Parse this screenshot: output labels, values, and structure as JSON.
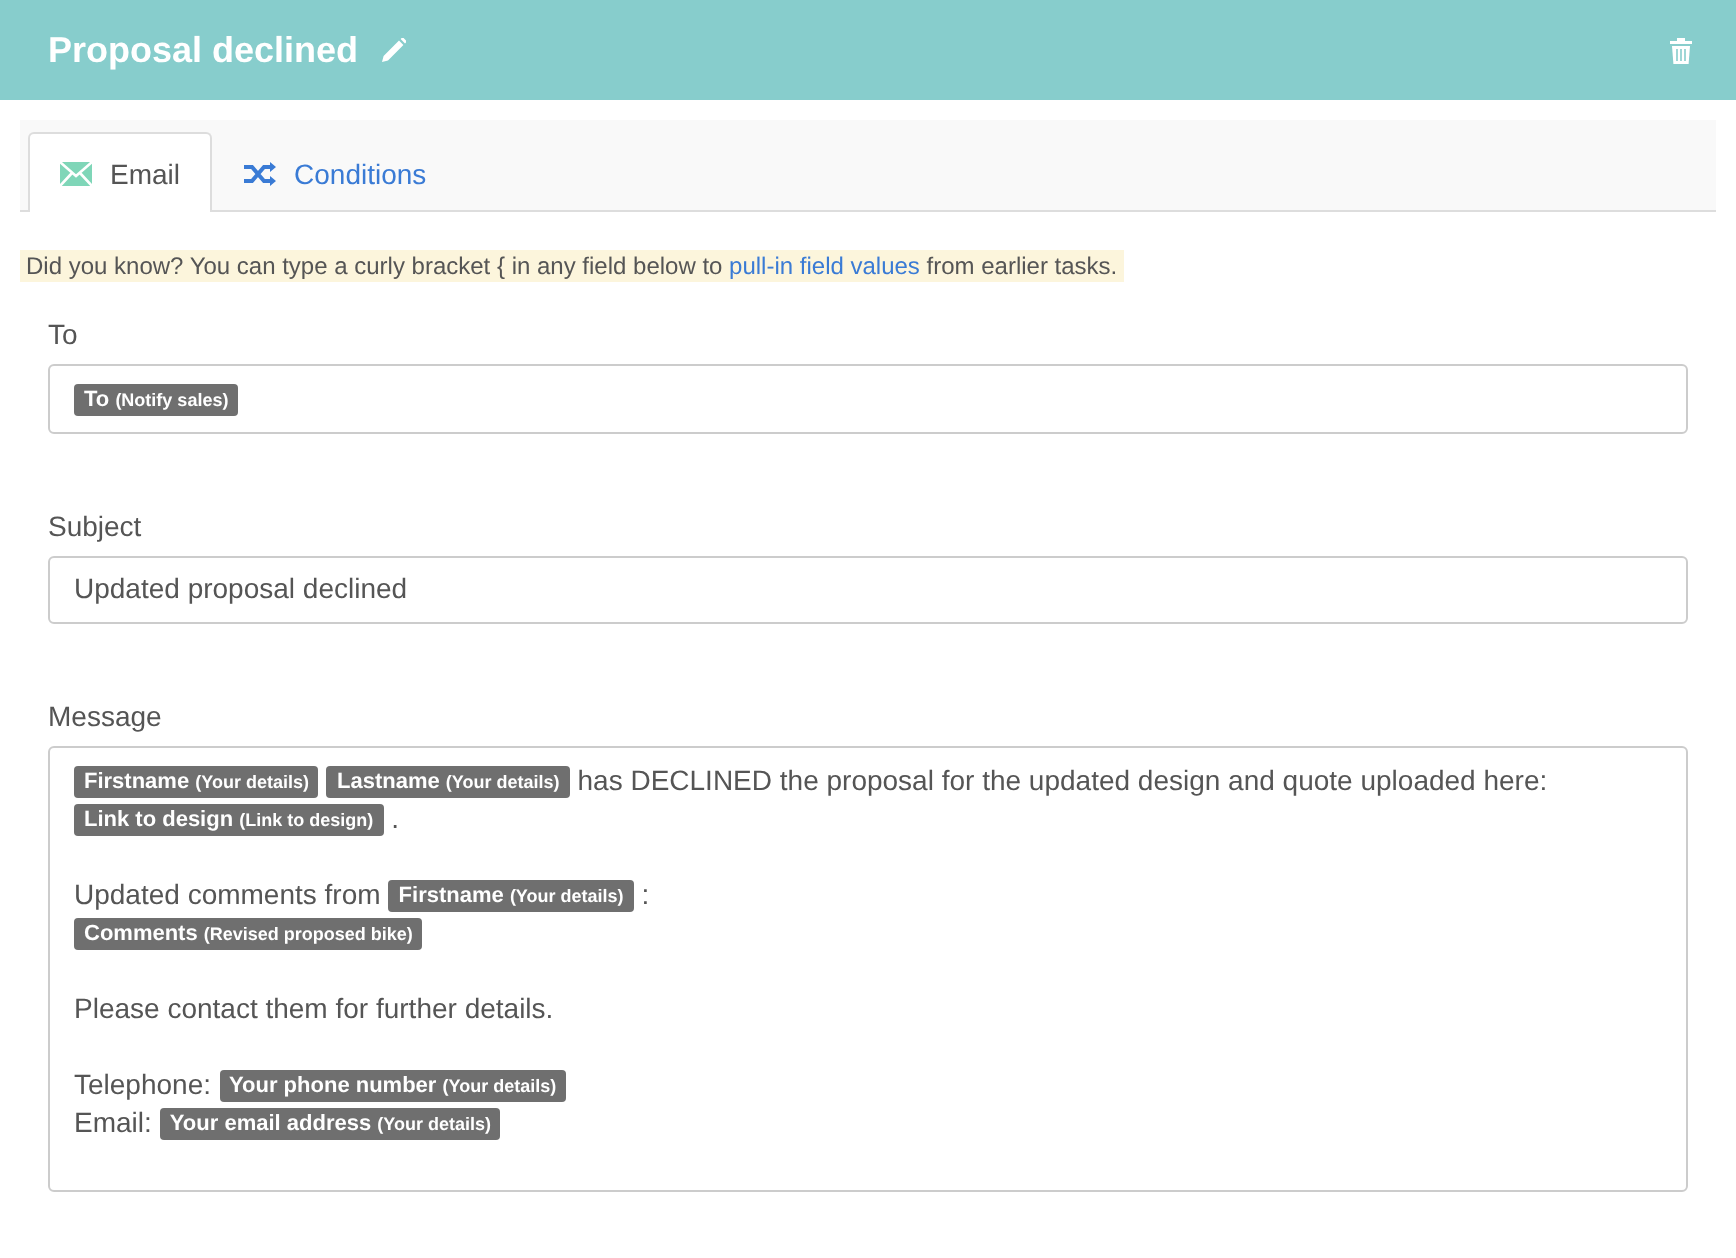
{
  "header": {
    "title": "Proposal declined"
  },
  "tabs": [
    {
      "label": "Email",
      "kind": "email",
      "selected": true
    },
    {
      "label": "Conditions",
      "kind": "conditions",
      "selected": false
    }
  ],
  "hint": {
    "before": "Did you know? You can type a curly bracket { in any field below to",
    "link": "pull-in field values",
    "after": "from earlier tasks."
  },
  "fields": [
    {
      "label": "To",
      "kind": "tags",
      "paragraphs": [
        [
          [
            {
              "kind": "tag",
              "name": "To",
              "source": "(Notify sales)"
            }
          ]
        ]
      ]
    },
    {
      "label": "Subject",
      "kind": "text",
      "value": "Updated proposal declined"
    },
    {
      "label": "Message",
      "kind": "tags",
      "paragraphs": [
        [
          [
            {
              "kind": "tag",
              "name": "Firstname",
              "source": "(Your details)"
            },
            {
              "kind": "tag",
              "name": "Lastname",
              "source": "(Your details)"
            },
            {
              "kind": "text",
              "text": "has DECLINED the proposal for the updated design and quote uploaded here:"
            }
          ],
          [
            {
              "kind": "tag",
              "name": "Link to design",
              "source": "(Link to design)"
            },
            {
              "kind": "text",
              "text": "."
            }
          ]
        ],
        [
          [
            {
              "kind": "text",
              "text": "Updated comments from"
            },
            {
              "kind": "tag",
              "name": "Firstname",
              "source": "(Your details)"
            },
            {
              "kind": "text",
              "text": ":"
            }
          ],
          [
            {
              "kind": "tag",
              "name": "Comments",
              "source": "(Revised proposed bike)"
            }
          ]
        ],
        [
          [
            {
              "kind": "text",
              "text": "Please contact them for further details."
            }
          ]
        ],
        [
          [
            {
              "kind": "text",
              "text": "Telephone:"
            },
            {
              "kind": "tag",
              "name": "Your phone number",
              "source": "(Your details)"
            }
          ],
          [
            {
              "kind": "text",
              "text": "Email:"
            },
            {
              "kind": "tag",
              "name": "Your email address",
              "source": "(Your details)"
            }
          ]
        ]
      ]
    }
  ]
}
